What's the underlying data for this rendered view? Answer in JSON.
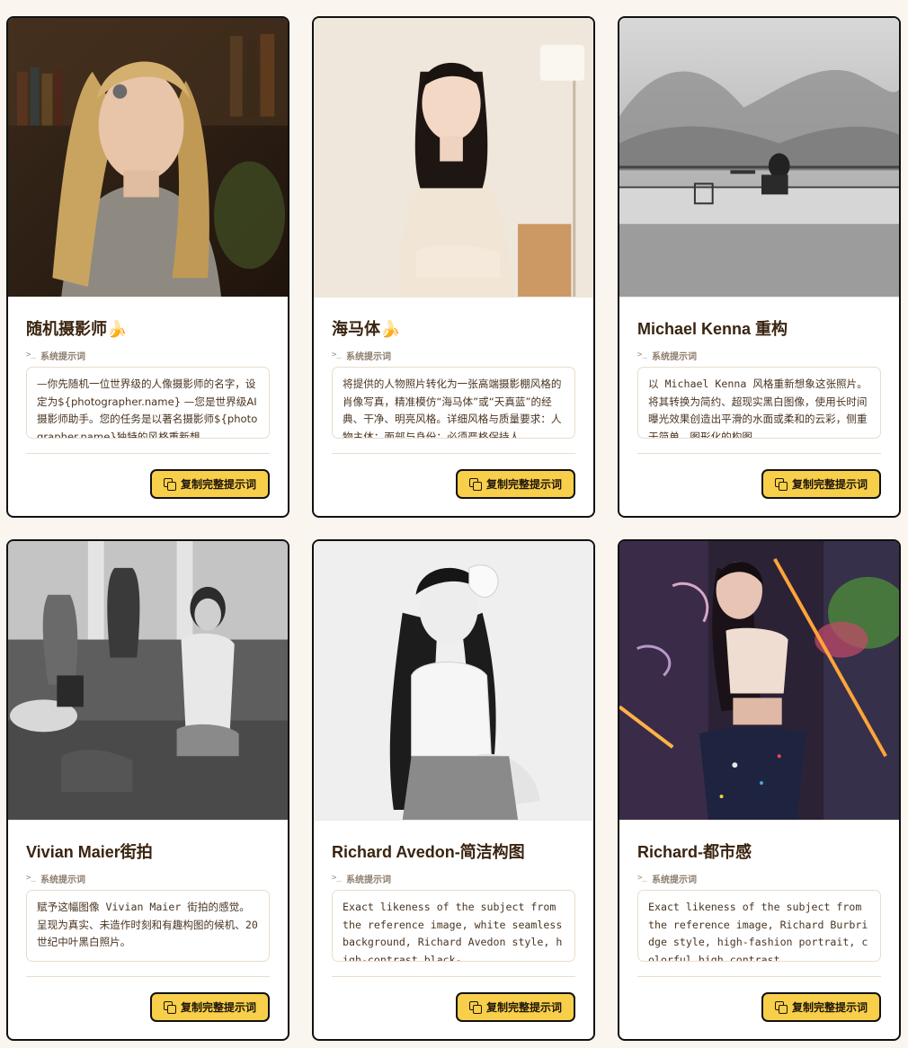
{
  "prompt_label": "系统提示词",
  "copy_label": "复制完整提示词",
  "cards": [
    {
      "title": "随机摄影师🍌",
      "image_desc": "portrait of blonde girl in library",
      "prompt": "—你先随机一位世界级的人像摄影师的名字，设定为${photographer.name} —您是世界级AI摄影师助手。您的任务是以著名摄影师${photographer.name}独特的风格重新想"
    },
    {
      "title": "海马体🍌",
      "image_desc": "studio portrait of woman seated in cream sweater",
      "prompt": "将提供的人物照片转化为一张高端摄影棚风格的肖像写真，精准模仿“海马体”或“天真蓝”的经典、干净、明亮风格。详细风格与质量要求：人物主体：面部与身份：必须严格保持人"
    },
    {
      "title": "Michael Kenna 重构",
      "image_desc": "black and white seated figure by calm water",
      "prompt": "以 Michael Kenna 风格重新想象这张照片。将其转换为简约、超现实黑白图像，使用长时间曝光效果创造出平滑的水面或柔和的云彩，侧重于简单、图形化的构图。"
    },
    {
      "title": "Vivian Maier街拍",
      "image_desc": "black and white street scene in airport lounge",
      "prompt": "赋予这幅图像 Vivian Maier 街拍的感觉。呈现为真实、未造作时刻和有趣构图的候机、20 世纪中叶黑白照片。"
    },
    {
      "title": "Richard Avedon-简洁构图",
      "image_desc": "black and white portrait on white seamless background",
      "prompt": "Exact likeness of the subject from the reference image, white seamless background, Richard Avedon style, high-contrast black-"
    },
    {
      "title": "Richard-都市感",
      "image_desc": "colorful urban portrait with neon and graffiti",
      "prompt": "Exact likeness of the subject from the reference image, Richard Burbridge style, high-fashion portrait, colorful high contrast"
    }
  ]
}
